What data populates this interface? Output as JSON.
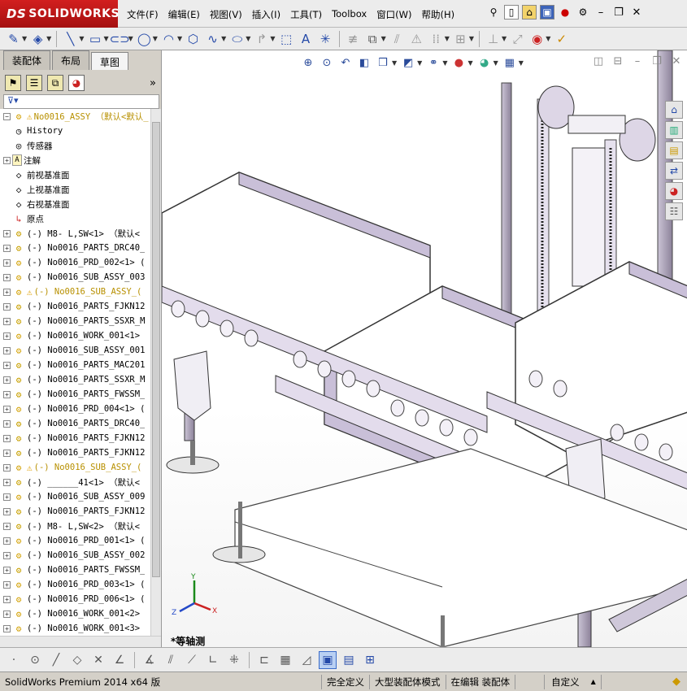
{
  "app": {
    "brand": "SOLIDWORKS",
    "brand_prefix": "DS"
  },
  "menu": [
    "文件(F)",
    "编辑(E)",
    "视图(V)",
    "插入(I)",
    "工具(T)",
    "Toolbox",
    "窗口(W)",
    "帮助(H)"
  ],
  "tabs": [
    "装配体",
    "布局",
    "草图"
  ],
  "active_tab": "草图",
  "tree": {
    "root": "No0016_ASSY （默认<默认_",
    "items": [
      {
        "label": "History",
        "icon": "history-icon",
        "expandable": false
      },
      {
        "label": "传感器",
        "icon": "sensor-icon",
        "expandable": false
      },
      {
        "label": "注解",
        "icon": "annotation-icon",
        "expandable": true
      },
      {
        "label": "前视基准面",
        "icon": "plane-icon",
        "expandable": false
      },
      {
        "label": "上视基准面",
        "icon": "plane-icon",
        "expandable": false
      },
      {
        "label": "右视基准面",
        "icon": "plane-icon",
        "expandable": false
      },
      {
        "label": "原点",
        "icon": "origin-icon",
        "expandable": false
      },
      {
        "label": "(-) M8-  L,SW<1> （默认<",
        "icon": "part-icon",
        "expandable": true
      },
      {
        "label": "(-) No0016_PARTS_DRC40_",
        "icon": "part-icon",
        "expandable": true
      },
      {
        "label": "(-) No0016_PRD_002<1> (",
        "icon": "assembly-icon",
        "expandable": true
      },
      {
        "label": "(-) No0016_SUB_ASSY_003",
        "icon": "assembly-icon",
        "expandable": true
      },
      {
        "label": "(-) No0016_SUB_ASSY_(",
        "icon": "assembly-icon",
        "expandable": true,
        "warning": true
      },
      {
        "label": "(-) No0016_PARTS_FJKN12",
        "icon": "part-icon",
        "expandable": true
      },
      {
        "label": "(-) No0016_PARTS_SSXR_M",
        "icon": "part-icon",
        "expandable": true
      },
      {
        "label": "(-) No0016_WORK_001<1>",
        "icon": "assembly-icon",
        "expandable": true
      },
      {
        "label": "(-) No0016_SUB_ASSY_001",
        "icon": "assembly-icon",
        "expandable": true
      },
      {
        "label": "(-) No0016_PARTS_MAC201",
        "icon": "part-icon",
        "expandable": true
      },
      {
        "label": "(-) No0016_PARTS_SSXR_M",
        "icon": "part-icon",
        "expandable": true
      },
      {
        "label": "(-) No0016_PARTS_FWSSM_",
        "icon": "part-icon",
        "expandable": true
      },
      {
        "label": "(-) No0016_PRD_004<1> (",
        "icon": "assembly-icon",
        "expandable": true
      },
      {
        "label": "(-) No0016_PARTS_DRC40_",
        "icon": "part-icon",
        "expandable": true
      },
      {
        "label": "(-) No0016_PARTS_FJKN12",
        "icon": "part-icon",
        "expandable": true
      },
      {
        "label": "(-) No0016_PARTS_FJKN12",
        "icon": "part-icon",
        "expandable": true
      },
      {
        "label": "(-) No0016_SUB_ASSY_(",
        "icon": "assembly-icon",
        "expandable": true,
        "warning": true
      },
      {
        "label": "(-) ______41<1> （默认<",
        "icon": "part-icon",
        "expandable": true
      },
      {
        "label": "(-) No0016_SUB_ASSY_009",
        "icon": "assembly-icon",
        "expandable": true
      },
      {
        "label": "(-) No0016_PARTS_FJKN12",
        "icon": "part-icon",
        "expandable": true
      },
      {
        "label": "(-) M8-  L,SW<2> （默认<",
        "icon": "part-icon",
        "expandable": true
      },
      {
        "label": "(-) No0016_PRD_001<1> (",
        "icon": "assembly-icon",
        "expandable": true
      },
      {
        "label": "(-) No0016_SUB_ASSY_002",
        "icon": "assembly-icon",
        "expandable": true
      },
      {
        "label": "(-) No0016_PARTS_FWSSM_",
        "icon": "part-icon",
        "expandable": true
      },
      {
        "label": "(-) No0016_PRD_003<1> (",
        "icon": "assembly-icon",
        "expandable": true
      },
      {
        "label": "(-) No0016_PRD_006<1> (",
        "icon": "assembly-icon",
        "expandable": true
      },
      {
        "label": "(-) No0016_WORK_001<2>",
        "icon": "assembly-icon",
        "expandable": true
      },
      {
        "label": "(-) No0016_WORK_001<3>",
        "icon": "assembly-icon",
        "expandable": true
      }
    ]
  },
  "viewport": {
    "view_label": "*等轴测",
    "axis_labels": {
      "x": "X",
      "y": "Y",
      "z": "Z"
    }
  },
  "status": {
    "app_version": "SolidWorks Premium 2014 x64 版",
    "definition": "完全定义",
    "mode": "大型装配体模式",
    "editing": "在编辑 装配体",
    "units": "自定义"
  }
}
